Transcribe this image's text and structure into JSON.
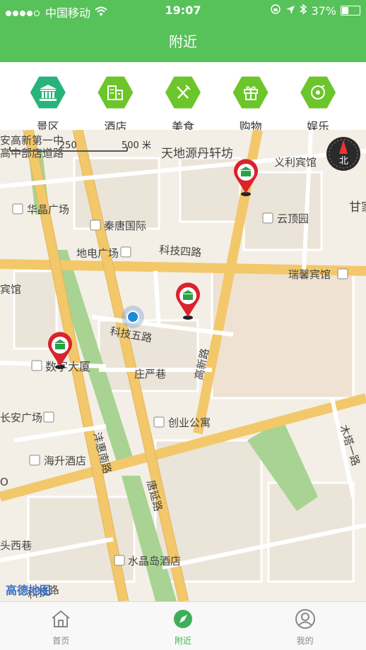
{
  "status_bar": {
    "carrier": "中国移动",
    "time": "19:07",
    "battery": "37%"
  },
  "header": {
    "title": "附近"
  },
  "categories": [
    {
      "label": "景区",
      "icon": "landmark-icon"
    },
    {
      "label": "酒店",
      "icon": "hotel-icon"
    },
    {
      "label": "美食",
      "icon": "fork-knife-icon"
    },
    {
      "label": "购物",
      "icon": "gift-icon"
    },
    {
      "label": "娱乐",
      "icon": "music-disc-icon"
    }
  ],
  "map": {
    "scale_label": "500 米",
    "scale_small": "250",
    "compass_label": "北",
    "provider": "高德地图",
    "labels": {
      "gaoxin1": "安高新第一中",
      "gaoxin2": "高中部店道路",
      "tiandi": "天地源丹轩坊",
      "yili": "义利宾馆",
      "ganjia": "甘家",
      "huajing": "华晶广场",
      "qintang": "秦唐国际",
      "yunding": "云顶园",
      "keji4": "科技四路",
      "didian": "地电广场",
      "ruixin": "瑞馨宾馆",
      "binguan": "宾馆",
      "keji5": "科技五路",
      "shuma": "数字大厦",
      "gaoxin": "高新路",
      "zhuangyan": "庄严巷",
      "chuangye": "创业公寓",
      "anguang": "长安广场",
      "haisheng": "海升酒店",
      "fengxi": "沣惠南路",
      "tangyan": "唐延路",
      "mutaer": "木塔一路",
      "toux": "头西巷",
      "shuijing": "水晶岛酒店",
      "kejilu": "科技路",
      "o": "O"
    }
  },
  "tabs": [
    {
      "label": "首页",
      "icon": "home-icon"
    },
    {
      "label": "附近",
      "icon": "compass-icon"
    },
    {
      "label": "我的",
      "icon": "user-icon"
    }
  ],
  "colors": {
    "brand_green": "#58c25a",
    "active_tab": "#3fae59",
    "pin_red": "#d9232d",
    "road_yellow": "#f2c86b",
    "park_green": "#a8d392"
  }
}
